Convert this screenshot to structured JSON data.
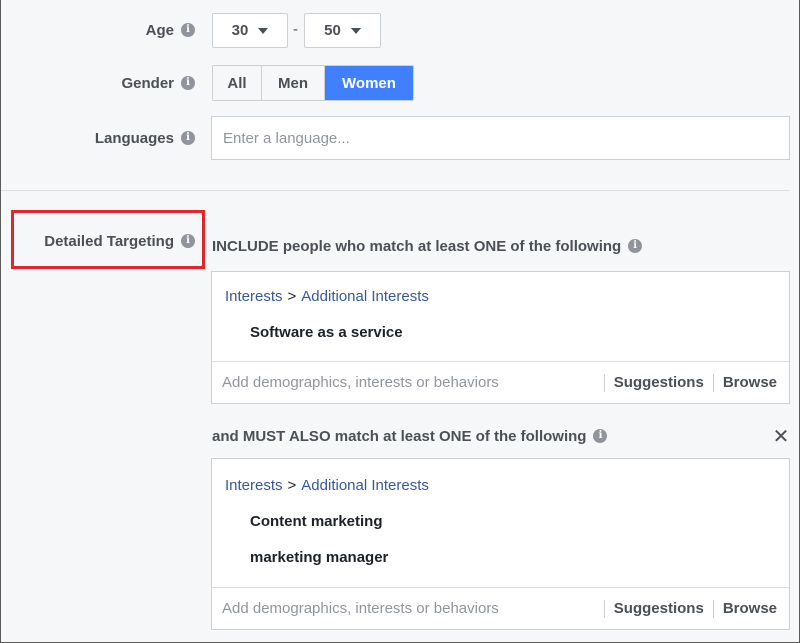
{
  "age": {
    "label": "Age",
    "min": "30",
    "max": "50",
    "separator": "-"
  },
  "gender": {
    "label": "Gender",
    "options": [
      "All",
      "Men",
      "Women"
    ],
    "selected": "Women"
  },
  "languages": {
    "label": "Languages",
    "placeholder": "Enter a language..."
  },
  "detailed_targeting": {
    "label": "Detailed Targeting",
    "include_heading": "INCLUDE people who match at least ONE of the following",
    "include_box": {
      "crumb_parent": "Interests",
      "crumb_sep": ">",
      "crumb_child": "Additional Interests",
      "items": [
        "Software as a service"
      ],
      "input_placeholder": "Add demographics, interests or behaviors",
      "suggestions": "Suggestions",
      "browse": "Browse"
    },
    "narrow_heading": "and MUST ALSO match at least ONE of the following",
    "narrow_box": {
      "crumb_parent": "Interests",
      "crumb_sep": ">",
      "crumb_child": "Additional Interests",
      "items": [
        "Content marketing",
        "marketing manager"
      ],
      "input_placeholder": "Add demographics, interests or behaviors",
      "suggestions": "Suggestions",
      "browse": "Browse"
    }
  },
  "icons": {
    "info": "i",
    "close": "✕"
  },
  "colors": {
    "accent": "#4080ff",
    "link": "#365899",
    "highlight": "#e0252b"
  }
}
